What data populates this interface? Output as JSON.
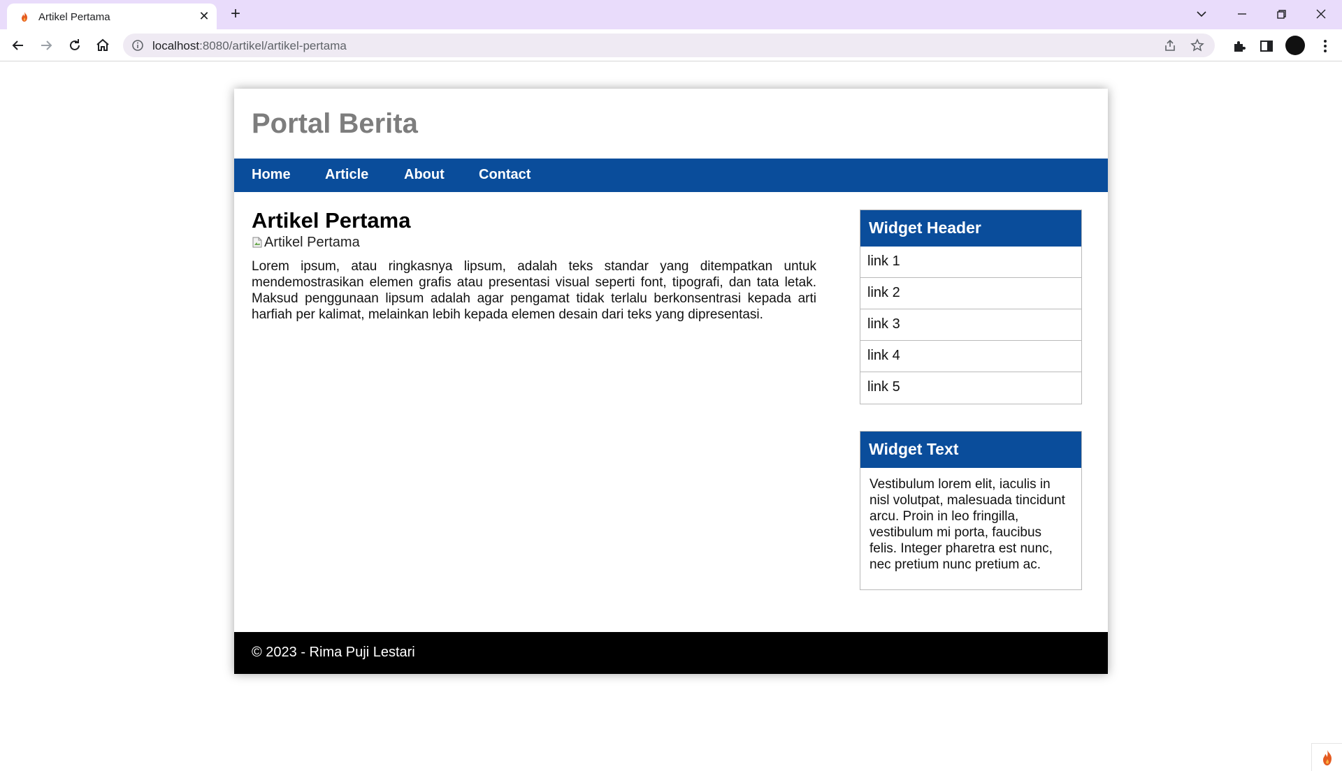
{
  "browser": {
    "tab_title": "Artikel Pertama",
    "url_host": "localhost",
    "url_rest": ":8080/artikel/artikel-pertama",
    "icons": [
      "flame-icon",
      "close-icon",
      "plus-icon",
      "chevron-down-icon",
      "minimize-icon",
      "restore-icon",
      "close-window-icon",
      "back-icon",
      "forward-icon",
      "reload-icon",
      "home-icon",
      "info-icon",
      "share-icon",
      "star-icon",
      "extensions-icon",
      "sidepanel-icon",
      "kebab-menu-icon"
    ]
  },
  "site": {
    "title": "Portal Berita",
    "brand_color": "#0a4d9b",
    "nav": [
      "Home",
      "Article",
      "About",
      "Contact"
    ]
  },
  "article": {
    "title": "Artikel Pertama",
    "image_alt": "Artikel Pertama",
    "body": "Lorem ipsum, atau ringkasnya lipsum, adalah teks standar yang ditempatkan untuk mendemostrasikan elemen grafis atau presentasi visual seperti font, tipografi, dan tata letak. Maksud penggunaan lipsum adalah agar pengamat tidak terlalu berkonsentrasi kepada arti harfiah per kalimat, melainkan lebih kepada elemen desain dari teks yang dipresentasi."
  },
  "sidebar": {
    "widget1": {
      "header": "Widget Header",
      "links": [
        "link 1",
        "link 2",
        "link 3",
        "link 4",
        "link 5"
      ]
    },
    "widget2": {
      "header": "Widget Text",
      "text": "Vestibulum lorem elit, iaculis in nisl volutpat, malesuada tincidunt arcu. Proin in leo fringilla, vestibulum mi porta, faucibus felis. Integer pharetra est nunc, nec pretium nunc pretium ac."
    }
  },
  "footer": {
    "text": "© 2023 - Rima Puji Lestari"
  }
}
